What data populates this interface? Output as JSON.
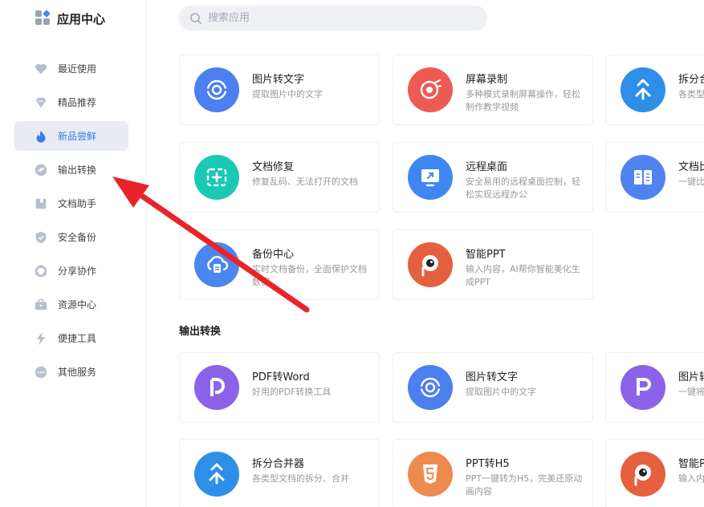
{
  "app": {
    "title": "应用中心"
  },
  "search": {
    "placeholder": "搜索应用"
  },
  "sidebar": {
    "items": [
      {
        "label": "最近使用",
        "icon": "heart-icon"
      },
      {
        "label": "精品推荐",
        "icon": "diamond-icon"
      },
      {
        "label": "新品尝鲜",
        "icon": "flame-icon",
        "active": true
      },
      {
        "label": "输出转换",
        "icon": "convert-icon"
      },
      {
        "label": "文档助手",
        "icon": "document-icon"
      },
      {
        "label": "安全备份",
        "icon": "shield-icon"
      },
      {
        "label": "分享协作",
        "icon": "share-icon"
      },
      {
        "label": "资源中心",
        "icon": "briefcase-icon"
      },
      {
        "label": "便捷工具",
        "icon": "lightning-icon"
      },
      {
        "label": "其他服务",
        "icon": "more-icon"
      }
    ]
  },
  "cards": [
    {
      "title": "图片转文字",
      "desc": "提取图片中的文字",
      "icon": "ocr-icon",
      "color": "#4c7ff0"
    },
    {
      "title": "屏幕录制",
      "desc": "多种模式录制屏幕操作，轻松制作教学视频",
      "icon": "record-icon",
      "color": "#ee5b52"
    },
    {
      "title": "拆分合",
      "desc": "各类型",
      "icon": "split-icon",
      "color": "#2e8fe8"
    },
    {
      "title": "文档修复",
      "desc": "修复乱码、无法打开的文档",
      "icon": "repair-icon",
      "color": "#19c9b3"
    },
    {
      "title": "远程桌面",
      "desc": "安全易用的远程桌面控制，轻松实现远程办公",
      "icon": "remote-icon",
      "color": "#3f86f2"
    },
    {
      "title": "文档比",
      "desc": "一键比出差异",
      "icon": "compare-icon",
      "color": "#4f84f0"
    },
    {
      "title": "备份中心",
      "desc": "实时文档备份，全面保护文档数据",
      "icon": "backup-icon",
      "color": "#4b86f0"
    },
    {
      "title": "智能PPT",
      "desc": "输入内容，AI帮你智能美化生成PPT",
      "icon": "ppt-ai-icon",
      "color": "#e5603f"
    }
  ],
  "section": {
    "title": "输出转换"
  },
  "cards2": [
    {
      "title": "PDF转Word",
      "desc": "好用的PDF转换工具",
      "icon": "pdf-word-icon",
      "color": "#8c63e8"
    },
    {
      "title": "图片转文字",
      "desc": "提取图片中的文字",
      "icon": "ocr-icon",
      "color": "#4c7ff0"
    },
    {
      "title": "图片转",
      "desc": "一键将",
      "icon": "img-pdf-icon",
      "color": "#8c63e8"
    },
    {
      "title": "拆分合并器",
      "desc": "各类型文档的拆分、合并",
      "icon": "split-icon",
      "color": "#2e8fe8"
    },
    {
      "title": "PPT转H5",
      "desc": "PPT一键转为H5，完美还原动画内容",
      "icon": "html5-icon",
      "color": "#ee8a4f"
    },
    {
      "title": "智能P",
      "desc": "输入内化生成",
      "icon": "ppt-ai-icon",
      "color": "#e5603f"
    }
  ],
  "annotation": {
    "type": "red-arrow",
    "color": "#e8242a"
  }
}
